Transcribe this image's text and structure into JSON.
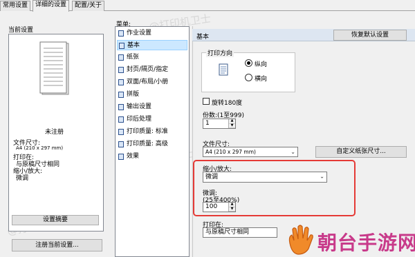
{
  "tabs": [
    "常用设置",
    "详细的设置",
    "配置/关于"
  ],
  "left": {
    "current_settings_title": "当前设置",
    "unregistered": "未注册",
    "info": {
      "file_size_label": "文件尺寸:",
      "file_size_value": "A4 (210 x 297 mm)",
      "print_on_label": "打印在:",
      "print_on_value": "与原稿尺寸相同",
      "zoom_label": "缩小/放大:",
      "zoom_value": "微调"
    },
    "settings_summary_button": "设置摘要",
    "register_button": "注册当前设置..."
  },
  "menu": {
    "title": "菜单:",
    "items": [
      "作业设置",
      "基本",
      "纸张",
      "封页/隔页/指定",
      "双面/布局/小册",
      "拼版",
      "输出设置",
      "印后处理",
      "打印质量: 标准",
      "打印质量: 高级",
      "效果"
    ],
    "selected": "基本"
  },
  "main": {
    "section_title": "基本",
    "restore_defaults_button": "恢复默认设置",
    "orientation": {
      "title": "打印方向",
      "portrait": "纵向",
      "landscape": "横向"
    },
    "rotate_label": "旋转180度",
    "copies_label": "份数:(1至999)",
    "copies_value": "1",
    "file_size_label": "文件尺寸:",
    "file_size_value": "A4 (210 x 297 mm)",
    "custom_size_button": "自定义纸张尺寸...",
    "zoom_label": "缩小/放大:",
    "zoom_value": "微调",
    "fine_label": "微调:",
    "fine_range": "(25至400%)",
    "fine_value": "100",
    "print_on_label": "打印在:",
    "print_on_value": "与原稿尺寸相同"
  },
  "watermark_text": "@打印机卫士",
  "brand": {
    "text": "朝台手游网",
    "color": "#c83a8a"
  }
}
